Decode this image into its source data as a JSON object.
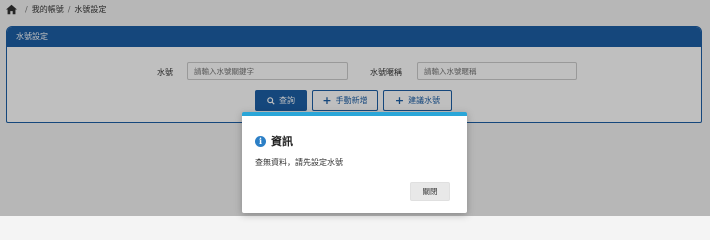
{
  "breadcrumb": {
    "home_icon": "home-icon",
    "items": [
      "我的帳號",
      "水號設定"
    ]
  },
  "panel": {
    "title": "水號設定",
    "fields": [
      {
        "label": "水號",
        "placeholder": "請輸入水號關鍵字"
      },
      {
        "label": "水號暱稱",
        "placeholder": "請輸入水號暱稱"
      }
    ],
    "buttons": {
      "search": "查詢",
      "manual_add": "手動新增",
      "create_water_no": "建議水號"
    }
  },
  "modal": {
    "title": "資訊",
    "icon": "info-icon",
    "message": "查無資料，請先設定水號",
    "close_label": "關閉"
  },
  "colors": {
    "primary": "#1d5fa6",
    "modal_accent": "#2aa6d8"
  }
}
